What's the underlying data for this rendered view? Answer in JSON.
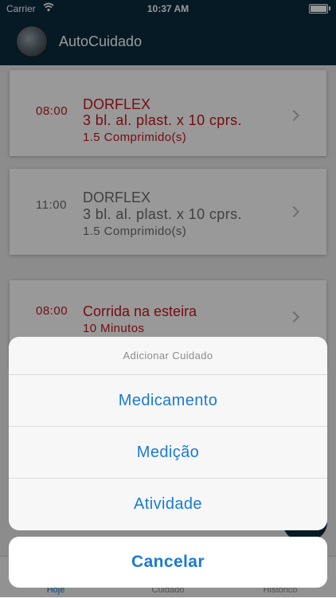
{
  "status_bar": {
    "carrier": "Carrier",
    "time": "10:37 AM"
  },
  "header": {
    "title": "AutoCuidado"
  },
  "cards": [
    {
      "time": "08:00",
      "name": "DORFLEX",
      "detail": "3 bl. al. plast. x 10 cprs.",
      "dose": "1.5 Comprimido(s)",
      "color": "#c4161c"
    },
    {
      "time": "11:00",
      "name": "DORFLEX",
      "detail": "3 bl. al. plast. x 10 cprs.",
      "dose": "1.5 Comprimido(s)",
      "color": "#6b6b6b"
    },
    {
      "time": "08:00",
      "name": "Corrida na esteira",
      "detail": "10 Minutos",
      "color": "#c4161c"
    }
  ],
  "tabs": [
    {
      "label": "Hoje",
      "active": true
    },
    {
      "label": "Cuidado",
      "active": false
    },
    {
      "label": "Histórico",
      "active": false
    }
  ],
  "action_sheet": {
    "title": "Adicionar Cuidado",
    "actions": [
      "Medicamento",
      "Medição",
      "Atividade"
    ],
    "cancel": "Cancelar"
  },
  "colors": {
    "nav": "#0b2c3f",
    "accent": "#1a7ad6",
    "overdue": "#c4161c",
    "scheduled": "#6b6b6b"
  },
  "icons": [
    "wifi-icon",
    "battery-icon",
    "chevron-right-icon",
    "add-icon"
  ]
}
